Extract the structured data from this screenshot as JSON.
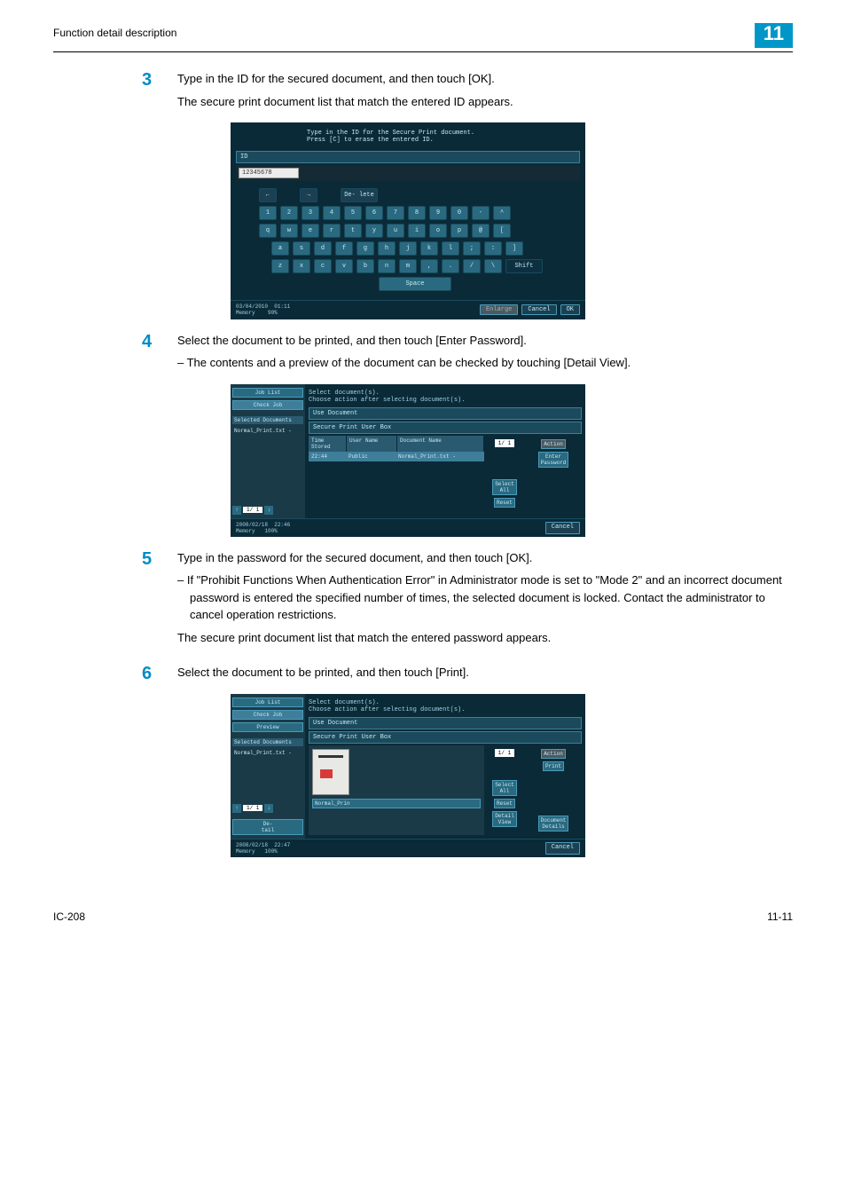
{
  "header": {
    "title": "Function detail description",
    "chapter": "11"
  },
  "steps": {
    "s3": {
      "num": "3",
      "line1": "Type in the ID for the secured document, and then touch [OK].",
      "line2": "The secure print document list that match the entered ID appears."
    },
    "s4": {
      "num": "4",
      "line1": "Select the document to be printed, and then touch [Enter Password].",
      "sub1": "The contents and a preview of the document can be checked by touching [Detail View]."
    },
    "s5": {
      "num": "5",
      "line1": "Type in the password for the secured document, and then touch [OK].",
      "sub1": "If \"Prohibit Functions When Authentication Error\" in Administrator mode is set to \"Mode 2\" and an incorrect document password is entered the specified number of times, the selected document is locked. Contact the administrator to cancel operation restrictions.",
      "line2": "The secure print document list that match the entered password appears."
    },
    "s6": {
      "num": "6",
      "line1": "Select the document to be printed, and then touch [Print]."
    }
  },
  "panel1": {
    "instr1": "Type in the ID for the Secure Print document.",
    "instr2": "Press [C] to erase the entered ID.",
    "id_label": "ID",
    "id_value": "12345678",
    "delete": "De-\nlete",
    "row0": [
      "←",
      "→"
    ],
    "row1": [
      "1",
      "2",
      "3",
      "4",
      "5",
      "6",
      "7",
      "8",
      "9",
      "0",
      "-",
      "^"
    ],
    "row2": [
      "q",
      "w",
      "e",
      "r",
      "t",
      "y",
      "u",
      "i",
      "o",
      "p",
      "@",
      "["
    ],
    "row3": [
      "a",
      "s",
      "d",
      "f",
      "g",
      "h",
      "j",
      "k",
      "l",
      ";",
      ":",
      "]"
    ],
    "row4": [
      "z",
      "x",
      "c",
      "v",
      "b",
      "n",
      "m",
      ",",
      ".",
      "/",
      "\\"
    ],
    "shift": "Shift",
    "space": "Space",
    "date": "03/04/2010",
    "time": "01:11",
    "mem": "Memory",
    "mem_pct": "90%",
    "enlarge": "Enlarge",
    "cancel": "Cancel",
    "ok": "OK"
  },
  "panel2": {
    "side": {
      "joblist": "Job List",
      "checkjob": "Check Job",
      "seldocs": "Selected Documents",
      "doc": "Normal_Print.txt -"
    },
    "instr": "Select document(s).\nChoose action after selecting document(s).",
    "tab1": "Use Document",
    "tab2": "Secure Print User Box",
    "cols": {
      "time": "Time\nStored",
      "user": "User Name",
      "docname": "Document Name"
    },
    "row": {
      "time": "22:44",
      "user": "Public",
      "docname": "Normal_Print.txt -"
    },
    "pg": "1/ 1",
    "action": "Action",
    "enterpw": "Enter\nPassword",
    "selectall": "Select\nAll",
    "reset": "Reset",
    "date": "2008/02/18",
    "time": "22:46",
    "mem": "Memory",
    "mem_pct": "100%",
    "cancel": "Cancel"
  },
  "panel3": {
    "side": {
      "joblist": "Job List",
      "checkjob": "Check Job",
      "preview": "Preview",
      "seldocs": "Selected Documents",
      "doc": "Normal_Print.txt -",
      "detail": "De-\ntail"
    },
    "instr": "Select document(s).\nChoose action after selecting document(s).",
    "tab1": "Use Document",
    "tab2": "Secure Print User Box",
    "thumb": "Normal_Prin",
    "pg": "1/ 1",
    "action": "Action",
    "print": "Print",
    "selectall": "Select\nAll",
    "reset": "Reset",
    "detailview": "Detail\nView",
    "docdetails": "Document\nDetails",
    "date": "2008/02/18",
    "time": "22:47",
    "mem": "Memory",
    "mem_pct": "100%",
    "cancel": "Cancel"
  },
  "footer": {
    "left": "IC-208",
    "right": "11-11"
  }
}
